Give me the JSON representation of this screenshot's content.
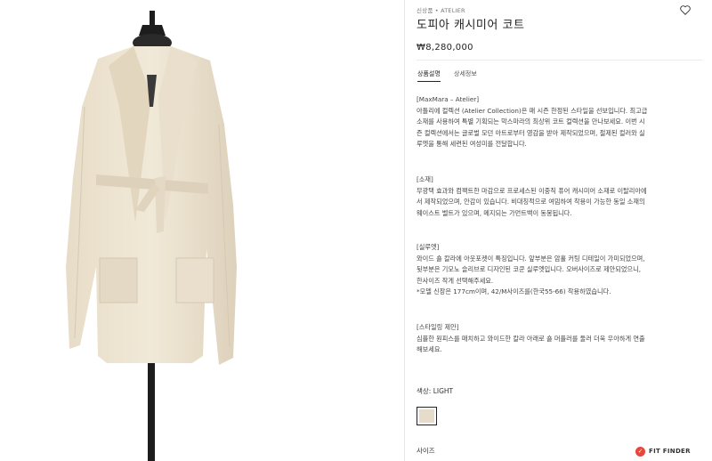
{
  "product": {
    "breadcrumb": "신상품 • ATELIER",
    "title": "도피아 캐시미어 코트",
    "price": "₩8,280,000",
    "wishlist_icon": "heart-icon"
  },
  "tabs": [
    {
      "label": "상품설명",
      "active": true
    },
    {
      "label": "상세정보",
      "active": false
    }
  ],
  "description": {
    "intro_head": "[MaxMara – Atelier]",
    "intro_lines": [
      "아틀리에 컬렉션 (Atelier Collection)은 매 시즌 한정된 스타일을 선보입니다. 최고급",
      "소재를 사용하여 특별 기획되는 막스마라의 최상위 코트 컬렉션을 만나보세요. 이번 시",
      "즌 컬렉션에서는 글로벌 모던 아트로부터 영감을 받아 제작되었으며, 절제된 컬러와 실",
      "루엣을 통해 세련된 여성미를 전달합니다."
    ],
    "fabric_head": "[소재]",
    "fabric_lines": [
      "무광택 효과와 컴팩트한 마감으로 프로세스된 이중직 퓨어 캐시미어 소재로 이탈리아에",
      "서 제작되었으며, 안감이 있습니다. 비대칭적으로 여밈하여 착용이 가능한 동일 소재의",
      "웨이스트 벨트가 있으며, 메지되는 가먼트백이 동봉됩니다."
    ],
    "silhouette_head": "[실루엣]",
    "silhouette_lines": [
      "와이드 숄 칼라에 아웃포켓이 특징입니다. 앞부분은 암홀 커팅 디테일이 가미되었으며,",
      "뒷부분은 기모노 슬리브로 디자인된 코쿤 실루엣입니다. 오버사이즈로 제안되었으니,",
      "한사이즈 작게 선택해주세요.",
      "*모델 신장은 177cm이며, 42/M사이즈를(한국55-66) 착용하였습니다."
    ],
    "styling_head": "[스타일링 제안]",
    "styling_lines": [
      "심플한 원피스를 매치하고 와이드한 칼라 아래로 숄 머플러를 둘러 더욱 우아하게 연출",
      "해보세요."
    ]
  },
  "options": {
    "color_label": "색상: LIGHT",
    "swatch_color": "#e6dccb",
    "size_label": "사이즈",
    "fit_finder_label": "FIT FINDER",
    "fit_finder_color": "#e8453c"
  }
}
